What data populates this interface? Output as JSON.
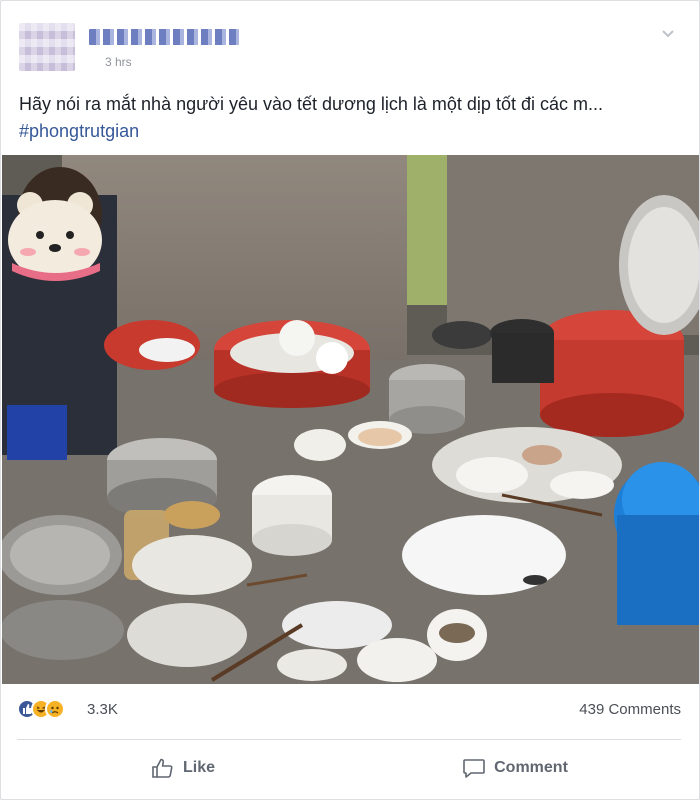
{
  "post": {
    "author": "",
    "timestamp": "3 hrs",
    "text": "Hãy nói ra mắt nhà người yêu vào tết dương lịch là một dịp tốt đi các m...",
    "hashtag": "#phongtrutgian"
  },
  "reactions": {
    "types": [
      "like-icon",
      "haha-icon",
      "sad-icon"
    ],
    "count": "3.3K"
  },
  "comments": {
    "count_label": "439 Comments"
  },
  "actions": {
    "like_label": "Like",
    "comment_label": "Comment"
  },
  "colors": {
    "link": "#365899",
    "like_blue": "#3b5998",
    "text_secondary": "#606770",
    "basin_red": "#d6453a",
    "basin_blue": "#1e7fd8"
  }
}
